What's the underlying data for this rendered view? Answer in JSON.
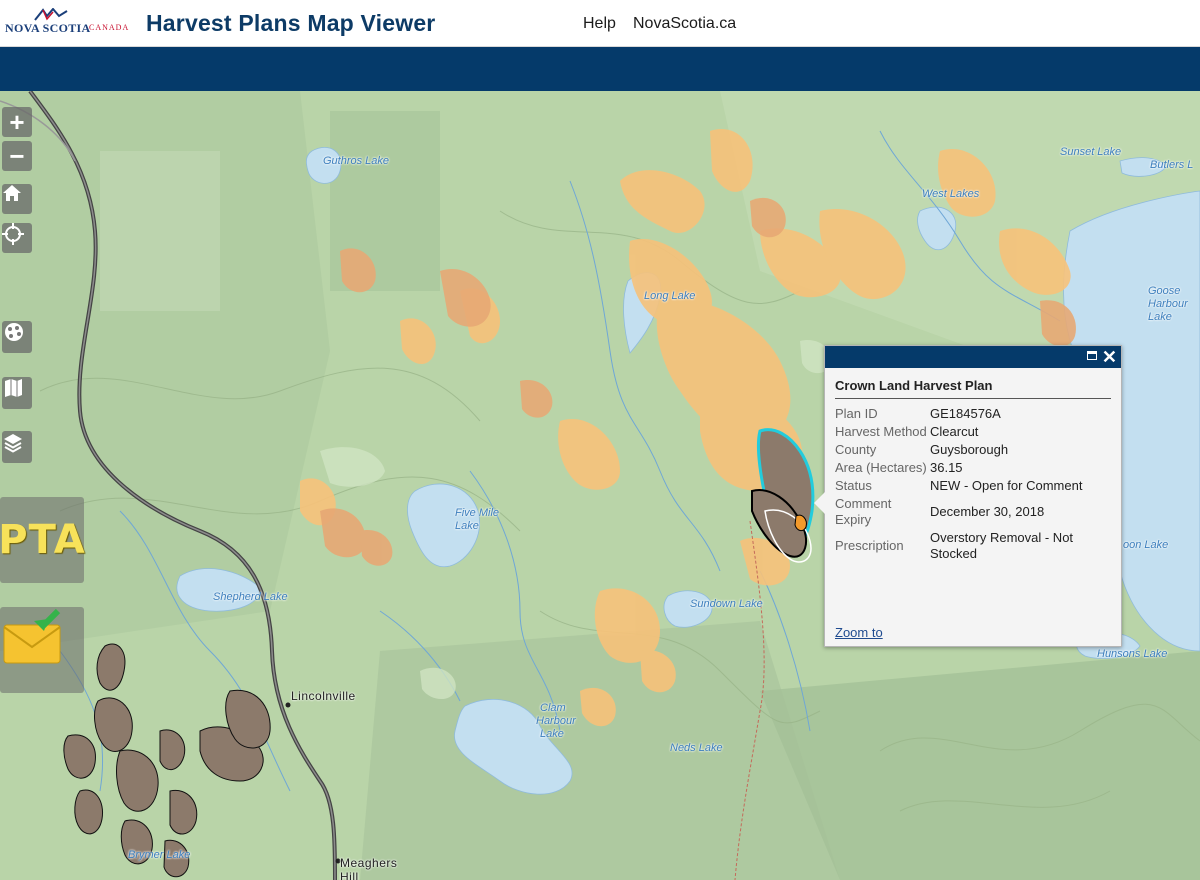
{
  "header": {
    "logo_text": "NOVA SCOTIA",
    "logo_sub": "CANADA",
    "title": "Harvest Plans Map Viewer",
    "links": {
      "help": "Help",
      "novascotia": "NovaScotia.ca"
    }
  },
  "colors": {
    "brand_blue": "#053a6a",
    "map_base": "#b9d4a8",
    "water": "#c3dff0",
    "harvest_orange": "#f7c27a",
    "selected_outline": "#22ccdd",
    "plan_brown": "#8c7a6b"
  },
  "map": {
    "place_labels": {
      "guthros": "Guthros Lake",
      "sunset": "Sunset Lake",
      "butlers": "Butlers L",
      "west_lakes": "West Lakes",
      "goose1": "Goose",
      "goose2": "Harbour",
      "goose3": "Lake",
      "long_lake": "Long Lake",
      "five_mile1": "Five Mile",
      "five_mile2": "Lake",
      "shepherd": "Shepherd Lake",
      "sundown": "Sundown Lake",
      "oon": "oon Lake",
      "hunsons": "Hunsons Lake",
      "clam1": "Clam",
      "clam2": "Harbour",
      "clam3": "Lake",
      "neds": "Neds Lake",
      "brymer": "Brymer Lake"
    },
    "towns": {
      "lincolnville": "Lincolnville",
      "meaghers": "Meaghers",
      "hill": "Hill"
    }
  },
  "tools": {
    "zoom_in": "+",
    "zoom_out": "−",
    "icons": [
      "home-icon",
      "locate-icon",
      "basemap-icon",
      "legend-icon",
      "layers-icon",
      "pta-icon",
      "email-icon"
    ],
    "pta_label": "PTA"
  },
  "popup": {
    "title": "Crown Land Harvest Plan",
    "rows": [
      {
        "key": "Plan ID",
        "value": "GE184576A"
      },
      {
        "key": "Harvest Method",
        "value": "Clearcut"
      },
      {
        "key": "County",
        "value": "Guysborough"
      },
      {
        "key": "Area (Hectares)",
        "value": "36.15"
      },
      {
        "key": "Status",
        "value": "NEW - Open for Comment"
      },
      {
        "key": "Comment Expiry",
        "value": "December 30, 2018"
      },
      {
        "key": "Prescription",
        "value": "Overstory Removal - Not Stocked"
      }
    ],
    "zoom_link": "Zoom to",
    "close_glyph": "✕"
  }
}
